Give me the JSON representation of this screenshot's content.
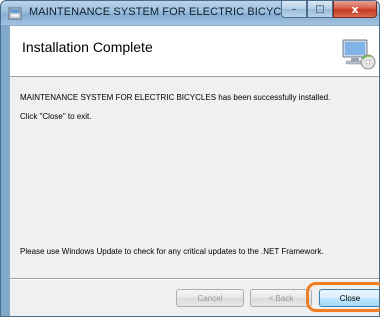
{
  "window": {
    "title": "MAINTENANCE SYSTEM FOR ELECTRIC BICYCLES",
    "caption": {
      "minimize": "–",
      "maximize": "□",
      "close": "x"
    }
  },
  "banner": {
    "title": "Installation Complete",
    "icon": "computer-setup-icon"
  },
  "body": {
    "success_message": "MAINTENANCE SYSTEM FOR ELECTRIC BICYCLES has been successfully installed.",
    "exit_hint": "Click \"Close\" to exit.",
    "update_note": "Please use Windows Update to check for any critical updates to the .NET Framework."
  },
  "buttons": {
    "cancel": "Cancel",
    "back": "< Back",
    "close": "Close"
  },
  "colors": {
    "highlight": "#f07d22",
    "close_button_border": "#3c7fb1"
  }
}
